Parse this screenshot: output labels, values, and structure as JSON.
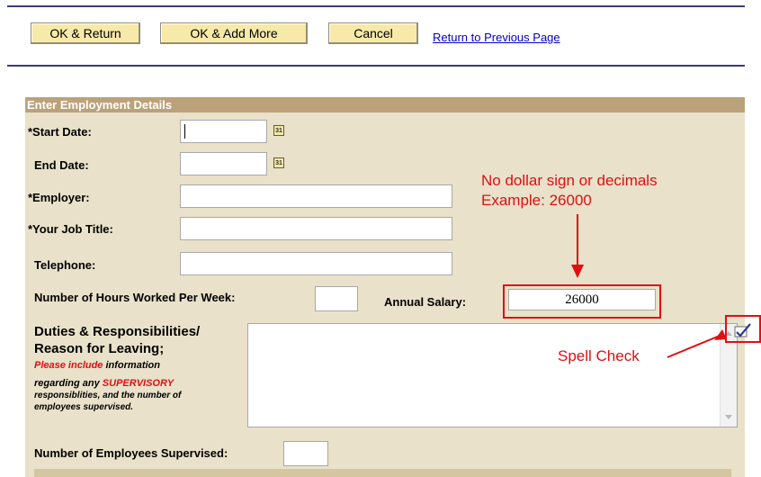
{
  "toolbar": {
    "ok_return": "OK & Return",
    "ok_add_more": "OK & Add More",
    "cancel": "Cancel",
    "return_link": "Return to Previous Page"
  },
  "panel": {
    "title": "Enter Employment Details",
    "start_date": "*Start Date:",
    "end_date": "End Date:",
    "employer": "*Employer:",
    "job_title": "*Your Job Title:",
    "telephone": "Telephone:",
    "hours": "Number of Hours Worked Per Week:",
    "salary_label": "Annual Salary:",
    "salary_value": "26000",
    "duties_line1": "Duties & Responsibilities/",
    "duties_line2": "Reason for Leaving;",
    "note_please": "Please include",
    "note_information": " information",
    "note_regarding": "regarding any ",
    "note_supervisory": "SUPERVISORY",
    "note_resp": "responsiblities, and the number of",
    "note_employees": "employees supervised.",
    "num_supervised": "Number of Employees Supervised:",
    "cal_text": "31"
  },
  "annotations": {
    "salary_note_1": "No dollar sign or decimals",
    "salary_note_2": "Example:  26000",
    "spell_check": "Spell Check"
  },
  "colors": {
    "panel_bg": "#e9e1c9",
    "panel_header": "#bba27a",
    "button_bg": "#f7e9a8",
    "annotation_red": "#dd1111",
    "link": "#0000cc"
  }
}
